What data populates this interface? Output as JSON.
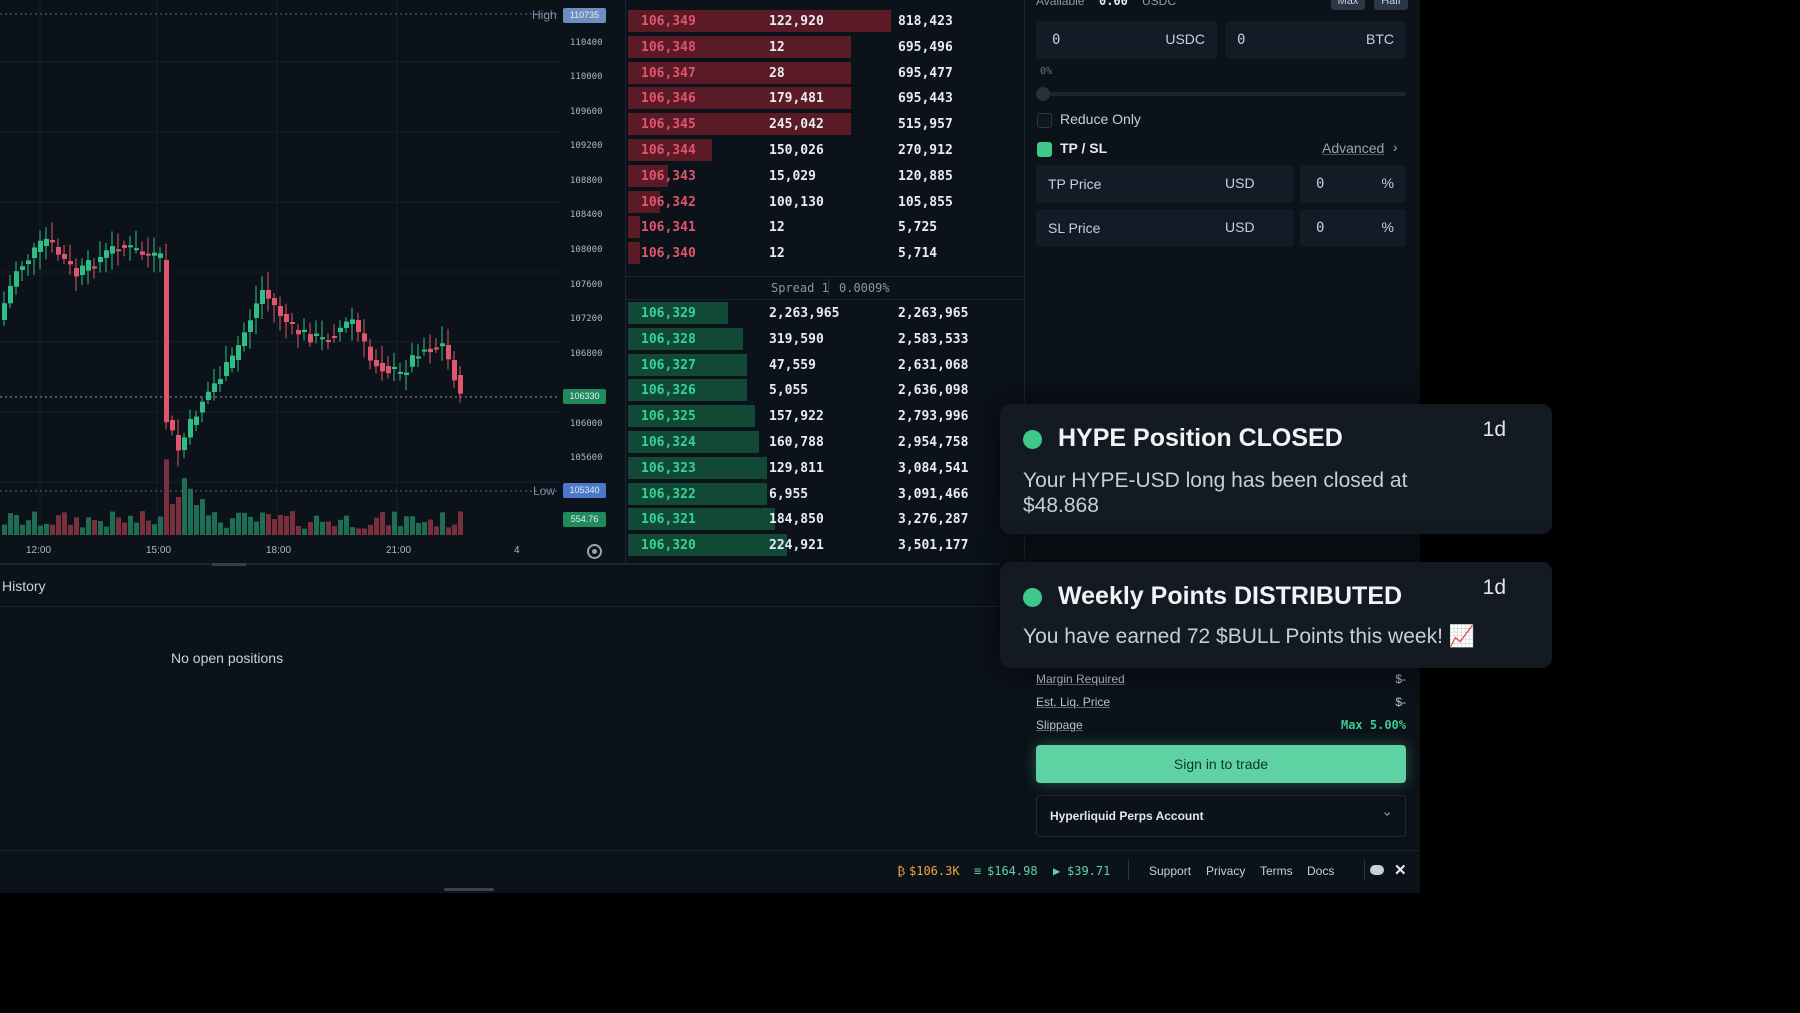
{
  "chart": {
    "y_axis_ticks": [
      "110400",
      "110000",
      "109600",
      "109200",
      "108800",
      "108400",
      "108000",
      "107600",
      "107200",
      "106800",
      "106000",
      "105600",
      "105200"
    ],
    "x_axis_ticks": [
      "12:00",
      "15:00",
      "18:00",
      "21:00",
      "4"
    ],
    "high_label": "High",
    "low_label": "Low",
    "high_tag": "110735",
    "current_tag": "106330",
    "low_tag": "105340",
    "volume_tag": "554.76",
    "settings_icon": "gear-icon",
    "colors": {
      "up": "#2fbf86",
      "down": "#e0566d"
    }
  },
  "order_book": {
    "asks": [
      {
        "price": "106,349",
        "size": "122,920",
        "total": "818,423",
        "depth": 0.66
      },
      {
        "price": "106,348",
        "size": "12",
        "total": "695,496",
        "depth": 0.56
      },
      {
        "price": "106,347",
        "size": "28",
        "total": "695,477",
        "depth": 0.56
      },
      {
        "price": "106,346",
        "size": "179,481",
        "total": "695,443",
        "depth": 0.56
      },
      {
        "price": "106,345",
        "size": "245,042",
        "total": "515,957",
        "depth": 0.56
      },
      {
        "price": "106,344",
        "size": "150,026",
        "total": "270,912",
        "depth": 0.21
      },
      {
        "price": "106,343",
        "size": "15,029",
        "total": "120,885",
        "depth": 0.1
      },
      {
        "price": "106,342",
        "size": "100,130",
        "total": "105,855",
        "depth": 0.08
      },
      {
        "price": "106,341",
        "size": "12",
        "total": "5,725",
        "depth": 0.03
      },
      {
        "price": "106,340",
        "size": "12",
        "total": "5,714",
        "depth": 0.03
      }
    ],
    "spread_label": "Spread 1",
    "spread_pct": "0.0009%",
    "bids": [
      {
        "price": "106,329",
        "size": "2,263,965",
        "total": "2,263,965",
        "depth": 0.25
      },
      {
        "price": "106,328",
        "size": "319,590",
        "total": "2,583,533",
        "depth": 0.29
      },
      {
        "price": "106,327",
        "size": "47,559",
        "total": "2,631,068",
        "depth": 0.3
      },
      {
        "price": "106,326",
        "size": "5,055",
        "total": "2,636,098",
        "depth": 0.3
      },
      {
        "price": "106,325",
        "size": "157,922",
        "total": "2,793,996",
        "depth": 0.32
      },
      {
        "price": "106,324",
        "size": "160,788",
        "total": "2,954,758",
        "depth": 0.33
      },
      {
        "price": "106,323",
        "size": "129,811",
        "total": "3,084,541",
        "depth": 0.35
      },
      {
        "price": "106,322",
        "size": "6,955",
        "total": "3,091,466",
        "depth": 0.35
      },
      {
        "price": "106,321",
        "size": "184,850",
        "total": "3,276,287",
        "depth": 0.37
      },
      {
        "price": "106,320",
        "size": "224,921",
        "total": "3,501,177",
        "depth": 0.4
      }
    ]
  },
  "positions": {
    "tab_label": "History",
    "empty_text": "No open positions"
  },
  "trade_panel": {
    "available_label": "Available",
    "available_value": "0.00",
    "available_unit": "USDC",
    "max_label": "Max",
    "half_label": "Half",
    "usdc_value": "0",
    "usdc_unit": "USDC",
    "btc_value": "0",
    "btc_unit": "BTC",
    "slider_pct": "0%",
    "reduce_only_label": "Reduce Only",
    "tpsl_label": "TP / SL",
    "advanced_label": "Advanced",
    "tp_label": "TP Price",
    "tp_unit": "USD",
    "tp_pct_value": "0",
    "sl_label": "SL Price",
    "sl_unit": "USD",
    "sl_pct_value": "0",
    "pct_sign": "%",
    "margin_required_label": "Margin Required",
    "margin_required_value": "$-",
    "liq_price_label": "Est. Liq. Price",
    "liq_price_value": "$-",
    "slippage_label": "Slippage",
    "slippage_value": "Max 5.00%",
    "signin_label": "Sign in to trade",
    "account_label": "Hyperliquid Perps Account"
  },
  "notifications": [
    {
      "title": "HYPE Position CLOSED",
      "age": "1d",
      "message": "Your HYPE-USD long has been closed at $48.868"
    },
    {
      "title": "Weekly Points DISTRIBUTED",
      "age": "1d",
      "message": "You have earned 72 $BULL Points this week! 📈"
    }
  ],
  "footer": {
    "btc_price": "$106.3K",
    "eth_price": "$164.98",
    "hype_price": "$39.71",
    "links": [
      "Support",
      "Privacy",
      "Terms",
      "Docs"
    ],
    "icons": [
      "discord-icon",
      "x-icon"
    ],
    "colors": {
      "btc": "#f2a43a",
      "eth": "#5fd2a4",
      "hype": "#5fd2a4"
    }
  }
}
